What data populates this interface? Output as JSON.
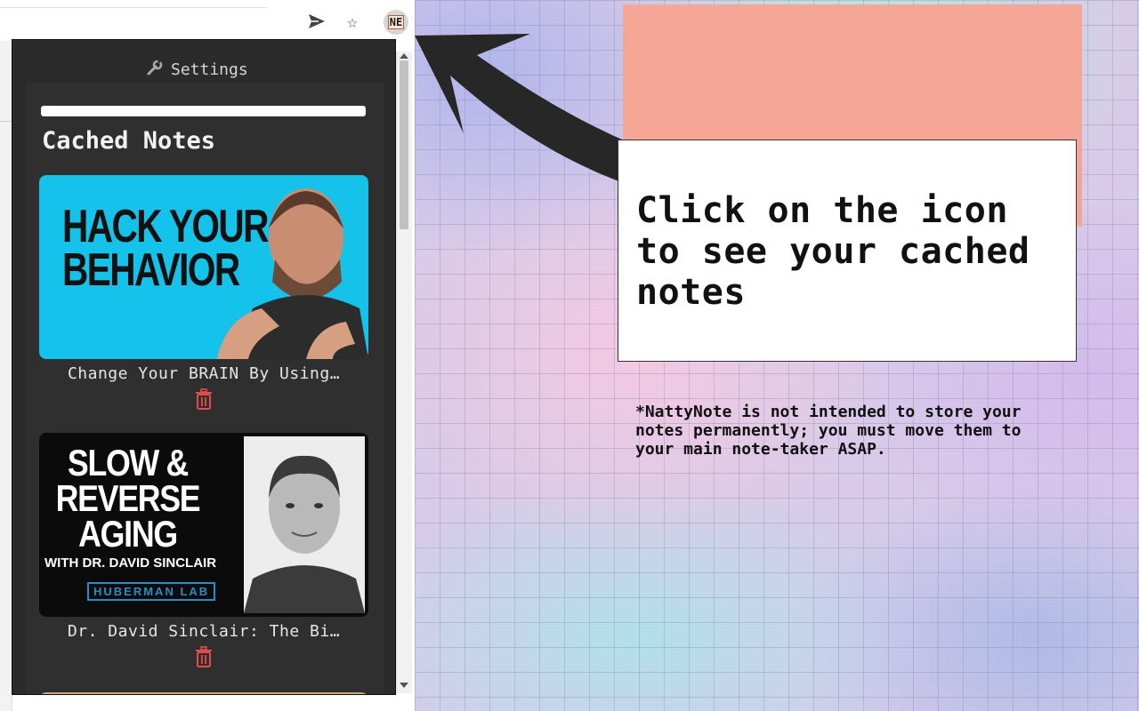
{
  "toolbar": {
    "share_icon": "send-arrow",
    "star_icon": "star",
    "extension_label": "NE"
  },
  "popup": {
    "settings_label": "Settings",
    "section_title": "Cached Notes",
    "notes": [
      {
        "title": "Change Your BRAIN By Using…",
        "thumbnail_text": [
          "HACK YOUR",
          "BEHAVIOR"
        ],
        "thumbnail_bg": "#15c2ea"
      },
      {
        "title": "Dr. David Sinclair: The Bi…",
        "thumbnail_text": [
          "SLOW &",
          "REVERSE",
          "AGING"
        ],
        "thumbnail_subtext": "WITH DR. DAVID SINCLAIR",
        "thumbnail_brand": "HUBERMAN LAB",
        "thumbnail_bg": "#0b0b0b"
      }
    ],
    "delete_icon": "trash",
    "delete_color": "#e54b4b"
  },
  "promo": {
    "headline": "Click on the icon to see your cached notes",
    "disclaimer": "*NattyNote is not intended to store your notes permanently; you must move them to your main note-taker ASAP.",
    "callout_shadow_color": "#f4a796"
  }
}
